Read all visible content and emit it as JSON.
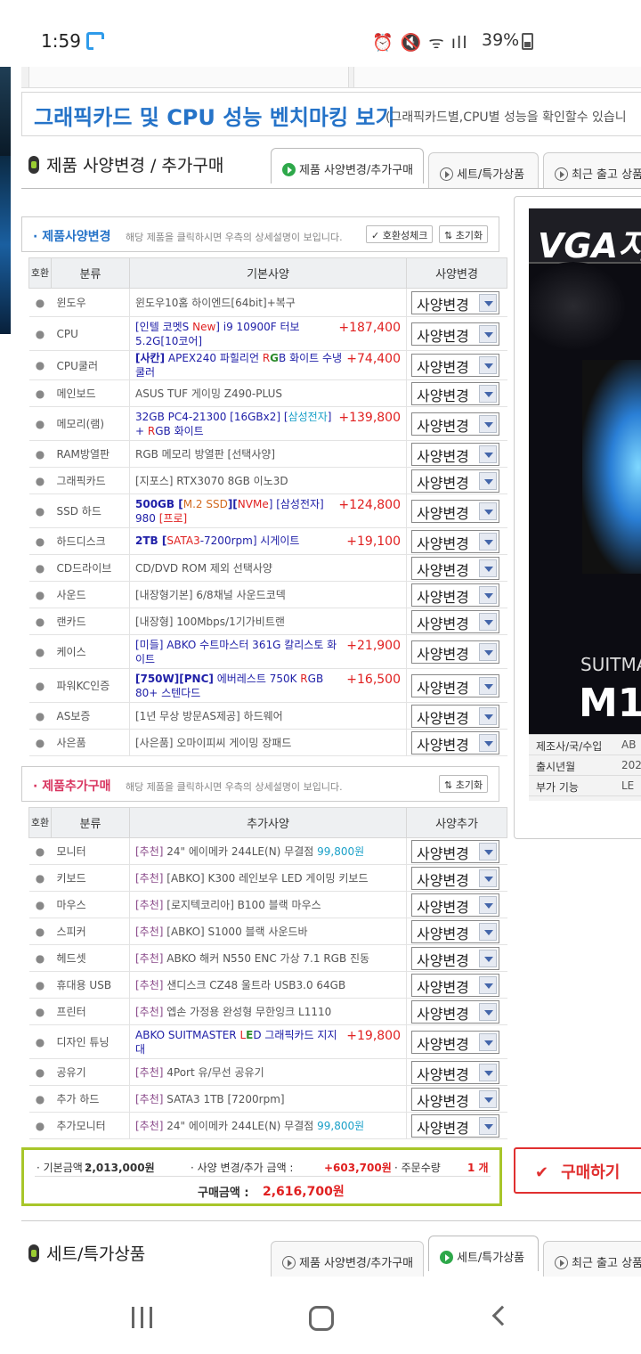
{
  "status": {
    "time": "1:59",
    "battery": "39%"
  },
  "benchmark": {
    "title": "그래픽카드 및 CPU 성능 벤치마킹 보기",
    "subtitle": "(그래픽카드별,CPU별 성능을 확인할수 있습니"
  },
  "section1": {
    "title": "제품 사양변경 / 추가구매",
    "tabs": [
      "제품 사양변경/추가구매",
      "세트/특가상품",
      "최근 출고 상품"
    ]
  },
  "spec_change": {
    "title": "제품사양변경",
    "desc": "해당 제품을 클릭하시면 우측의 상세설명이 보입니다.",
    "compat_btn": "호환성체크",
    "reset_btn": "초기화",
    "headers": {
      "compat": "호환",
      "category": "분류",
      "base": "기본사양",
      "change": "사양변경"
    },
    "select_label": "사양변경",
    "rows": [
      {
        "cat": "윈도우",
        "name": "윈도우10홈 하이엔드[64bit]+복구",
        "price": ""
      },
      {
        "cat": "CPU",
        "name_parts": [
          "[인텔 코멧S ",
          "New",
          "] i9 10900F 터보5.2G[10코어]"
        ],
        "price": "+187,400"
      },
      {
        "cat": "CPU쿨러",
        "name_parts": [
          "[사칸]",
          " APEX240 파힐리언 ",
          "R",
          "G",
          "B 화이트 수냉쿨러"
        ],
        "price": "+74,400"
      },
      {
        "cat": "메인보드",
        "name": "ASUS TUF 게이밍 Z490-PLUS",
        "price": ""
      },
      {
        "cat": "메모리(램)",
        "name_parts": [
          "32GB PC4-21300 [16GBx2] [",
          "삼성전자",
          "] + ",
          "R",
          "GB 화이트"
        ],
        "price": "+139,800"
      },
      {
        "cat": "RAM방열판",
        "name": "RGB 메모리 방열판 [선택사양]",
        "price": ""
      },
      {
        "cat": "그래픽카드",
        "name": "[지포스] RTX3070 8GB 이노3D",
        "price": ""
      },
      {
        "cat": "SSD 하드",
        "name_parts": [
          "500GB [",
          "M.2 SSD",
          "][",
          "NVMe",
          "] [삼성전자] 980 ",
          "[프로]"
        ],
        "price": "+124,800"
      },
      {
        "cat": "하드디스크",
        "name_parts": [
          "2TB [",
          "SATA3",
          "-7200rpm] 시게이트"
        ],
        "price": "+19,100"
      },
      {
        "cat": "CD드라이브",
        "name": "CD/DVD ROM 제외 선택사양",
        "price": ""
      },
      {
        "cat": "사운드",
        "name": "[내장형기본] 6/8채널 사운드코덱",
        "price": ""
      },
      {
        "cat": "랜카드",
        "name": "[내장형] 100Mbps/1기가비트랜",
        "price": ""
      },
      {
        "cat": "케이스",
        "name": "[미들] ABKO 수트마스터 361G 칼리스토 화이트",
        "price": "+21,900"
      },
      {
        "cat": "파워KC인증",
        "name_parts": [
          "[750W][PNC]",
          " 에버레스트 750K ",
          "R",
          "GB 80+ 스텐다드"
        ],
        "price": "+16,500"
      },
      {
        "cat": "AS보증",
        "name": "[1년 무상 방문AS제공] 하드웨어",
        "price": ""
      },
      {
        "cat": "사은품",
        "name": "[사은품] 오마이피씨 게이밍 장패드",
        "price": ""
      }
    ]
  },
  "add_purchase": {
    "title": "제품추가구매",
    "desc": "해당 제품을 클릭하시면 우측의 상세설명이 보입니다.",
    "reset_btn": "초기화",
    "headers": {
      "compat": "호환",
      "category": "분류",
      "extra": "추가사양",
      "add": "사양추가"
    },
    "select_label": "사양변경",
    "rows": [
      {
        "cat": "모니터",
        "tag": "[추천]",
        "name": " 24\" 에이메카 244LE(N) 무결점 ",
        "extra": "99,800원",
        "price": ""
      },
      {
        "cat": "키보드",
        "tag": "[추천]",
        "name": " [ABKO] K300 레인보우 LED 게이밍 키보드",
        "extra": "",
        "price": ""
      },
      {
        "cat": "마우스",
        "tag": "[추천]",
        "name": " [로지텍코리아] B100 블랙 마우스",
        "extra": "",
        "price": ""
      },
      {
        "cat": "스피커",
        "tag": "[추천]",
        "name": " [ABKO] S1000 블랙 사운드바",
        "extra": "",
        "price": ""
      },
      {
        "cat": "헤드셋",
        "tag": "[추천]",
        "name": " ABKO 해커 N550 ENC 가상 7.1 RGB 진동",
        "extra": "",
        "price": ""
      },
      {
        "cat": "휴대용 USB",
        "tag": "[추천]",
        "name": " 샌디스크 CZ48 울트라 USB3.0 64GB",
        "extra": "",
        "price": ""
      },
      {
        "cat": "프린터",
        "tag": "[추천]",
        "name": " 엡손 가정용 완성형 무한잉크 L1110",
        "extra": "",
        "price": ""
      },
      {
        "cat": "디자인 튜닝",
        "tag": "",
        "name_parts": [
          "ABKO SUITMASTER ",
          "L",
          "E",
          "D",
          " 그래픽카드 지지대"
        ],
        "extra": "",
        "price": "+19,800"
      },
      {
        "cat": "공유기",
        "tag": "[추천]",
        "name": " 4Port 유/무선 공유기",
        "extra": "",
        "price": ""
      },
      {
        "cat": "추가 하드",
        "tag": "[추천]",
        "name": " SATA3 1TB [7200rpm]",
        "extra": "",
        "price": ""
      },
      {
        "cat": "추가모니터",
        "tag": "[추천]",
        "name": " 24\" 에이메카 244LE(N) 무결점 ",
        "extra": "99,800원",
        "price": ""
      }
    ]
  },
  "preview": {
    "header": "VGA지",
    "brand": "SUITMA",
    "model": "M1",
    "info": [
      {
        "k": "제조사/국/수입",
        "v": "AB"
      },
      {
        "k": "출시년월",
        "v": "202"
      },
      {
        "k": "부가 기능",
        "v": "LE"
      }
    ]
  },
  "summary": {
    "base_label": "· 기본금액 : ",
    "base_value": "2,013,000원",
    "change_label": "· 사양 변경/추가 금액 :",
    "change_value": "+603,700원",
    "qty_label": "· 주문수량",
    "qty_value": "1 개",
    "total_label": "구매금액 :",
    "total_value": "2,616,700원"
  },
  "buy_button": "구매하기",
  "section2": {
    "title": "세트/특가상품",
    "tabs": [
      "제품 사양변경/추가구매",
      "세트/특가상품",
      "최근 출고 상품"
    ]
  },
  "colors": {
    "accent": "#2573c8",
    "price": "#e02020",
    "summary_border": "#a8c62a",
    "buy": "#e03030"
  }
}
